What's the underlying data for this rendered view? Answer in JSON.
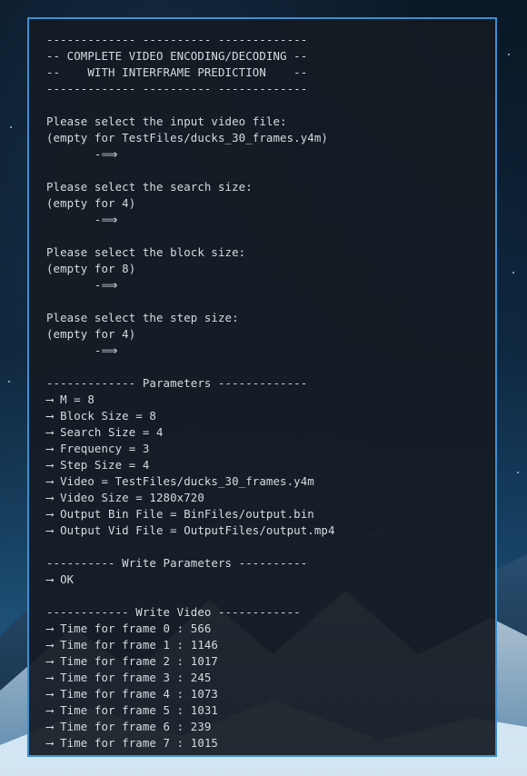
{
  "terminal": {
    "lines": [
      "------------- ---------- -------------",
      "-- COMPLETE VIDEO ENCODING/DECODING --",
      "--    WITH INTERFRAME PREDICTION    --",
      "------------- ---------- -------------",
      "",
      "Please select the input video file:",
      "(empty for TestFiles/ducks_30_frames.y4m)",
      "       -⟹",
      "",
      "Please select the search size:",
      "(empty for 4)",
      "       -⟹",
      "",
      "Please select the block size:",
      "(empty for 8)",
      "       -⟹",
      "",
      "Please select the step size:",
      "(empty for 4)",
      "       -⟹",
      "",
      "------------- Parameters -------------",
      "⟶ M = 8",
      "⟶ Block Size = 8",
      "⟶ Search Size = 4",
      "⟶ Frequency = 3",
      "⟶ Step Size = 4",
      "⟶ Video = TestFiles/ducks_30_frames.y4m",
      "⟶ Video Size = 1280x720",
      "⟶ Output Bin File = BinFiles/output.bin",
      "⟶ Output Vid File = OutputFiles/output.mp4",
      "",
      "---------- Write Parameters ----------",
      "⟶ OK",
      "",
      "------------ Write Video ------------",
      "⟶ Time for frame 0 : 566",
      "⟶ Time for frame 1 : 1146",
      "⟶ Time for frame 2 : 1017",
      "⟶ Time for frame 3 : 245",
      "⟶ Time for frame 4 : 1073",
      "⟶ Time for frame 5 : 1031",
      "⟶ Time for frame 6 : 239",
      "⟶ Time for frame 7 : 1015"
    ]
  }
}
